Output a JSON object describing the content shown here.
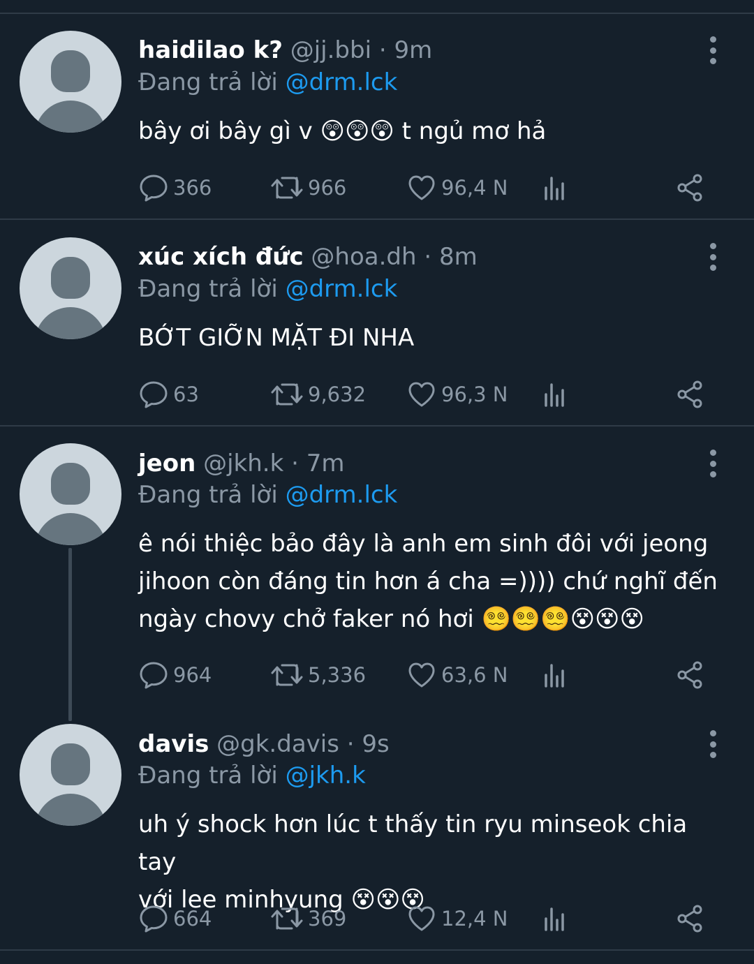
{
  "tweets": [
    {
      "name": "haidilao k?",
      "handle": "@jj.bbi",
      "dot": "·",
      "time": "9m",
      "reply_prefix": "Đang trả lời",
      "reply_to": "@drm.lck",
      "lines": [
        "bây ơi bây gì v 😲😲😲 t ngủ mơ hả"
      ],
      "replies": "366",
      "retweets": "966",
      "likes": "96,4 N"
    },
    {
      "name": "xúc xích đức",
      "handle": "@hoa.dh",
      "dot": "·",
      "time": "8m",
      "reply_prefix": "Đang trả lời",
      "reply_to": "@drm.lck",
      "lines": [
        "BỚT GIỠN MẶT ĐI NHA"
      ],
      "replies": "63",
      "retweets": "9,632",
      "likes": "96,3 N"
    },
    {
      "name": "jeon",
      "handle": "@jkh.k",
      "dot": "·",
      "time": "7m",
      "reply_prefix": "Đang trả lời",
      "reply_to": "@drm.lck",
      "lines": [
        "ê nói thiệc bảo đây là anh em sinh đôi với jeong",
        "jihoon còn đáng tin hơn á cha =)))) chứ nghĩ đến",
        "ngày chovy chở faker nó hơi 😵‍💫😵‍💫😵‍💫😵😵😵"
      ],
      "replies": "964",
      "retweets": "5,336",
      "likes": "63,6 N"
    },
    {
      "name": "davis",
      "handle": "@gk.davis",
      "dot": "·",
      "time": "9s",
      "reply_prefix": "Đang trả lời",
      "reply_to": "@jkh.k",
      "lines": [
        "uh ý shock hơn lúc t thấy tin ryu minseok chia tay",
        "với lee minhyung 😵😵😵"
      ],
      "replies": "664",
      "retweets": "369",
      "likes": "12,4 N"
    }
  ],
  "icons": {
    "reply": "reply-bubble-icon",
    "retweet": "retweet-icon",
    "like": "heart-icon",
    "views": "analytics-icon",
    "share": "share-icon",
    "menu": "more-vertical-icon"
  },
  "colors": {
    "background": "#15202b",
    "muted": "#8b98a5",
    "link": "#1d9bf0",
    "divider": "#2f3b47"
  }
}
